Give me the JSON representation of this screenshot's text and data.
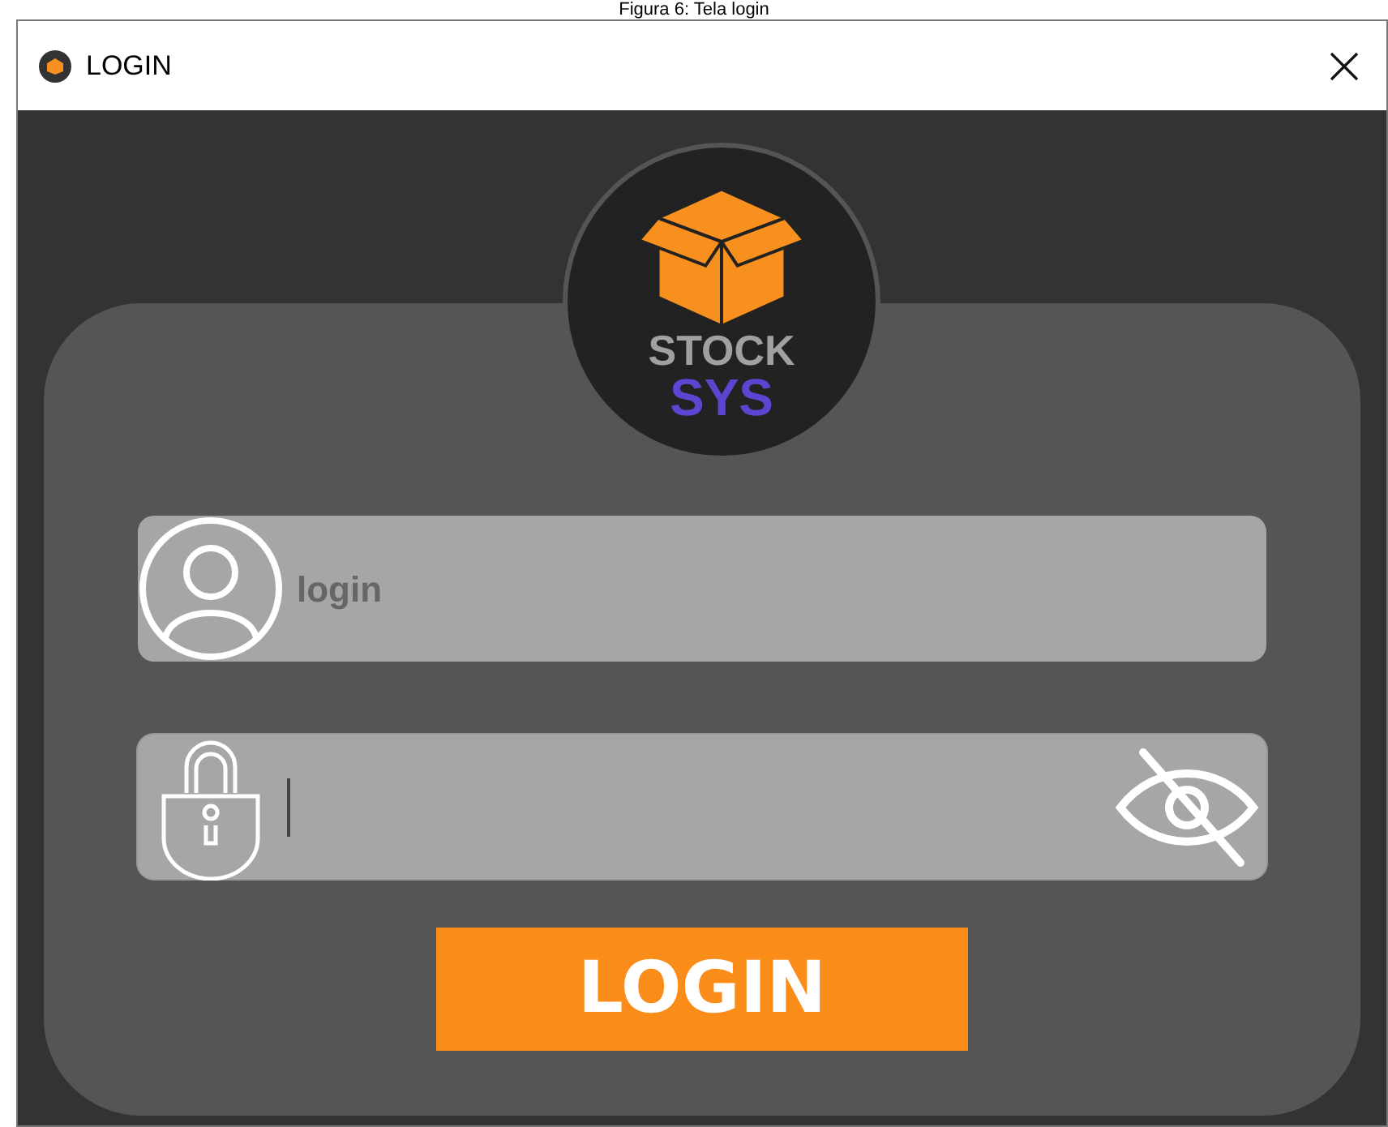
{
  "caption": "Figura 6: Tela login",
  "window": {
    "title": "LOGIN"
  },
  "logo": {
    "line_1": "STOCK",
    "line_2": "SYS"
  },
  "login_field": {
    "placeholder": "login"
  },
  "password_field": {
    "focused": true,
    "show_password": false
  },
  "login_button": {
    "label": "LOGIN"
  }
}
